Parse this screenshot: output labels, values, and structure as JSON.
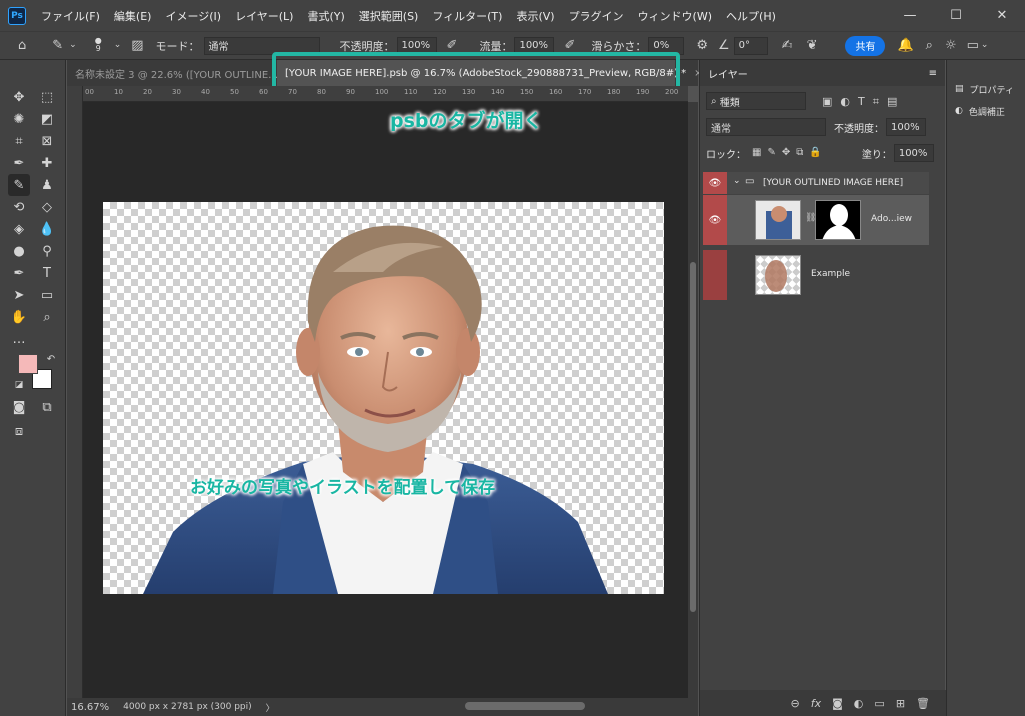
{
  "app": {
    "logo_text": "Ps"
  },
  "menu": [
    "ファイル(F)",
    "編集(E)",
    "イメージ(I)",
    "レイヤー(L)",
    "書式(Y)",
    "選択範囲(S)",
    "フィルター(T)",
    "表示(V)",
    "プラグイン",
    "ウィンドウ(W)",
    "ヘルプ(H)"
  ],
  "window_controls": {
    "minimize": "—",
    "maximize": "☐",
    "close": "✕"
  },
  "options": {
    "brush_size": "9",
    "mode_label": "モード：",
    "mode_value": "通常",
    "opacity_label": "不透明度：",
    "opacity_value": "100%",
    "flow_label": "流量：",
    "flow_value": "100%",
    "smoothing_label": "滑らかさ：",
    "smoothing_value": "0%",
    "angle_value": "0°",
    "share_label": "共有"
  },
  "tabs": [
    {
      "label": "名称未設定 3 @ 22.6% ([YOUR OUTLINE…"
    },
    {
      "label": "[YOUR IMAGE HERE].psb @ 16.7% (AdobeStock_290888731_Preview, RGB/8#) *",
      "close": "×"
    }
  ],
  "ruler": {
    "ticks": [
      "00",
      "10",
      "20",
      "30",
      "40",
      "50",
      "60",
      "70",
      "80",
      "90",
      "100",
      "110",
      "120",
      "130",
      "140",
      "150",
      "160",
      "170",
      "180",
      "190",
      "200"
    ]
  },
  "annotations": {
    "tab_callout": "psbのタブが開く",
    "canvas_callout": "お好みの写真やイラストを配置して保存"
  },
  "status": {
    "zoom": "16.67%",
    "doc_info": "4000 px x 2781 px (300 ppi)",
    "arrow": "〉"
  },
  "layers_panel": {
    "title": "レイヤー",
    "filter_label": "種類",
    "blend_mode": "通常",
    "opacity_label": "不透明度：",
    "opacity_value": "100%",
    "lock_label": "ロック：",
    "fill_label": "塗り：",
    "fill_value": "100%",
    "group_name": "[YOUR OUTLINED IMAGE HERE]",
    "layers": [
      {
        "name": "Ado...iew"
      },
      {
        "name": "Example"
      }
    ]
  },
  "right_panel": {
    "items": [
      {
        "label": "プロパティ"
      },
      {
        "label": "色調補正"
      }
    ]
  },
  "colors": {
    "accent": "#23b7a4",
    "foreground": "#f5b9b9",
    "background": "#ffffff",
    "visibility": "#b24a4a"
  }
}
